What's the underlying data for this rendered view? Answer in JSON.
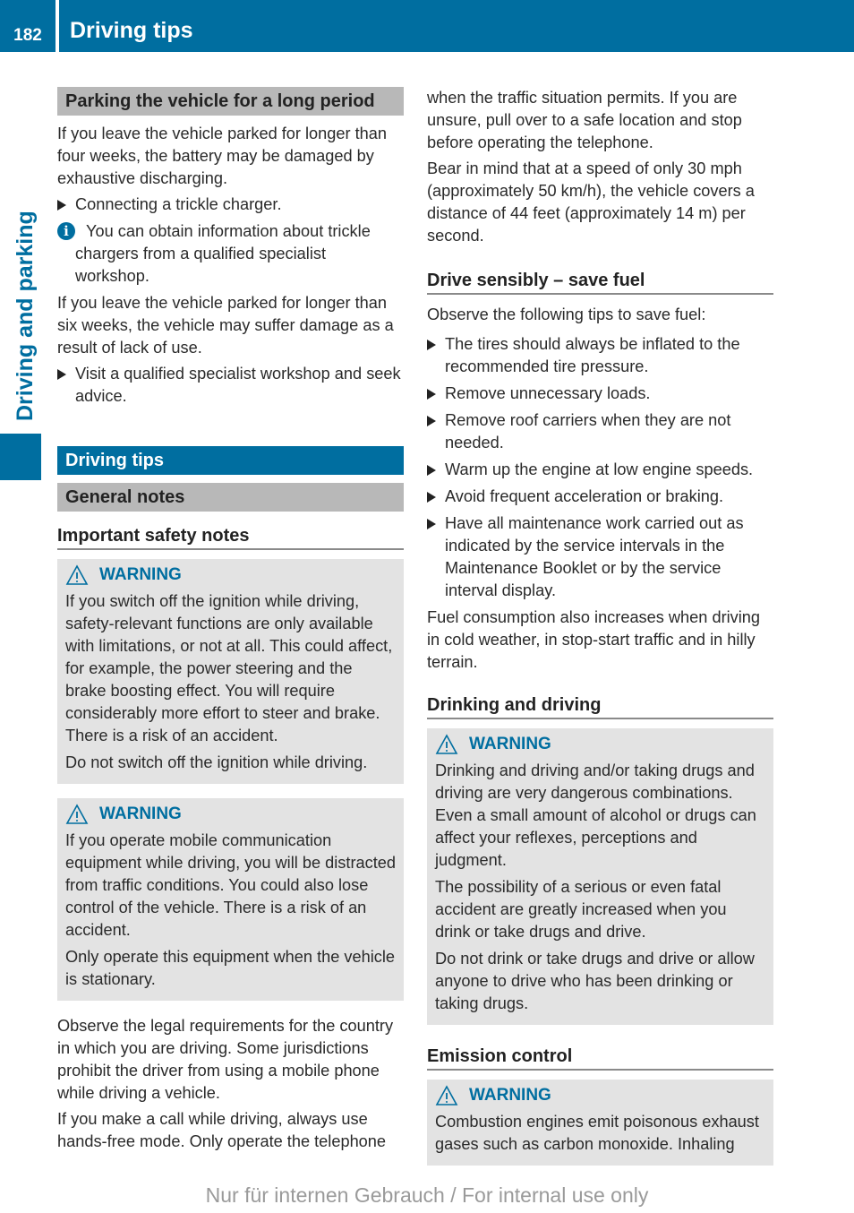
{
  "header": {
    "page_number": "182",
    "title": "Driving tips",
    "side_tab": "Driving and parking",
    "accent_color": "#006ea0"
  },
  "left": {
    "parking": {
      "heading": "Parking the vehicle for a long period",
      "p1": "If you leave the vehicle parked for longer than four weeks, the battery may be damaged by exhaustive discharging.",
      "step1": "Connecting a trickle charger.",
      "info": "You can obtain information about trickle chargers from a qualified specialist workshop.",
      "p2": "If you leave the vehicle parked for longer than six weeks, the vehicle may suffer damage as a result of lack of use.",
      "step2": "Visit a qualified specialist workshop and seek advice."
    },
    "driving_tips_heading": "Driving tips",
    "general_notes_heading": "General notes",
    "safety_heading": "Important safety notes",
    "warning1": {
      "label": "WARNING",
      "p1": "If you switch off the ignition while driving, safety-relevant functions are only available with limitations, or not at all. This could affect, for example, the power steering and the brake boosting effect. You will require considerably more effort to steer and brake. There is a risk of an accident.",
      "p2": "Do not switch off the ignition while driving."
    },
    "warning2": {
      "label": "WARNING",
      "p1": "If you operate mobile communication equipment while driving, you will be distracted from traffic conditions. You could also lose control of the vehicle. There is a risk of an accident.",
      "p2": "Only operate this equipment when the vehicle is stationary."
    },
    "p3": "Observe the legal requirements for the country in which you are driving. Some jurisdictions prohibit the driver from using a mobile phone while driving a vehicle.",
    "p4": "If you make a call while driving, always use hands-free mode. Only operate the telephone"
  },
  "right": {
    "p1": "when the traffic situation permits. If you are unsure, pull over to a safe location and stop before operating the telephone.",
    "p2": "Bear in mind that at a speed of only 30 mph (approximately 50 km/h), the vehicle covers a distance of 44 feet (approximately 14 m) per second.",
    "fuel": {
      "heading": "Drive sensibly – save fuel",
      "intro": "Observe the following tips to save fuel:",
      "tips": [
        "The tires should always be inflated to the recommended tire pressure.",
        "Remove unnecessary loads.",
        "Remove roof carriers when they are not needed.",
        "Warm up the engine at low engine speeds.",
        "Avoid frequent acceleration or braking.",
        "Have all maintenance work carried out as indicated by the service intervals in the Maintenance Booklet or by the service interval display."
      ],
      "outro": "Fuel consumption also increases when driving in cold weather, in stop-start traffic and in hilly terrain."
    },
    "drinking": {
      "heading": "Drinking and driving",
      "label": "WARNING",
      "p1": "Drinking and driving and/or taking drugs and driving are very dangerous combinations. Even a small amount of alcohol or drugs can affect your reflexes, perceptions and judgment.",
      "p2": "The possibility of a serious or even fatal accident are greatly increased when you drink or take drugs and drive.",
      "p3": "Do not drink or take drugs and drive or allow anyone to drive who has been drinking or taking drugs."
    },
    "emission": {
      "heading": "Emission control",
      "label": "WARNING",
      "p1": "Combustion engines emit poisonous exhaust gases such as carbon monoxide. Inhaling"
    }
  },
  "footer": "Nur für internen Gebrauch / For internal use only"
}
